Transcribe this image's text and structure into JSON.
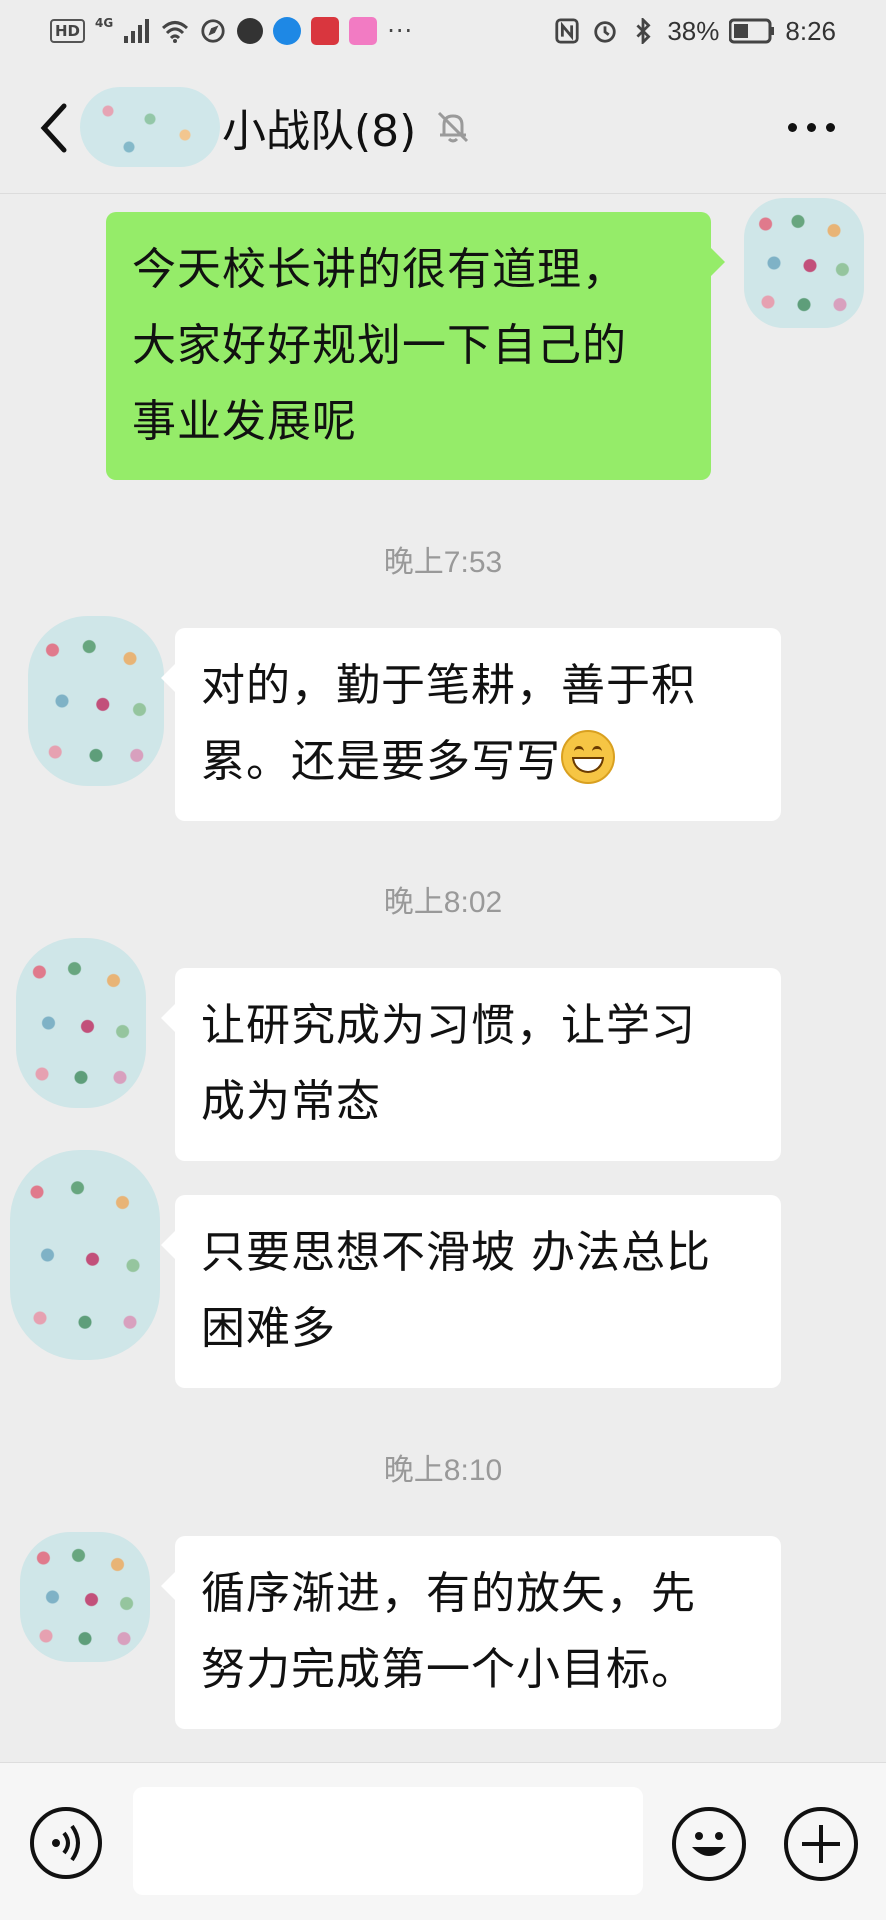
{
  "status_bar": {
    "hd_label": "HD",
    "network_label": "4G",
    "battery": "38%",
    "time": "8:26",
    "more_indicator": "···",
    "icons": [
      "hd-icon",
      "signal-icon",
      "wifi-icon",
      "browser-icon",
      "qq-icon",
      "blue-app-icon",
      "red-app-icon",
      "pink-app-icon",
      "nfc-icon",
      "alarm-icon",
      "bluetooth-icon",
      "battery-icon"
    ]
  },
  "header": {
    "title": "小战队(8)",
    "icons": [
      "back-icon",
      "mute-bell-icon",
      "more-icon"
    ]
  },
  "messages": [
    {
      "side": "out",
      "text_lines": [
        "今天校长讲的很有道理，",
        "大家好好规划一下自己的",
        "事业发展呢"
      ]
    },
    {
      "type": "time",
      "text": "晚上7:53"
    },
    {
      "side": "in",
      "text_lines": [
        "对的，勤于笔耕，善于积",
        "累。还是要多写写"
      ],
      "emoji": "grin-emoji-icon"
    },
    {
      "type": "time",
      "text": "晚上8:02"
    },
    {
      "side": "in",
      "text_lines": [
        "让研究成为习惯，让学习",
        "成为常态"
      ]
    },
    {
      "side": "in",
      "text_lines": [
        "只要思想不滑坡 办法总比",
        "困难多"
      ]
    },
    {
      "type": "time",
      "text": "晚上8:10"
    },
    {
      "side": "in",
      "text_lines": [
        "循序渐进，有的放矢，先",
        "努力完成第一个小目标。"
      ]
    }
  ],
  "input_bar": {
    "icons": [
      "voice-icon",
      "emoji-icon",
      "plus-icon"
    ],
    "input_value": ""
  },
  "colors": {
    "background": "#ededed",
    "outgoing_bubble": "#95ec69",
    "incoming_bubble": "#ffffff",
    "timestamp_text": "#999999"
  }
}
